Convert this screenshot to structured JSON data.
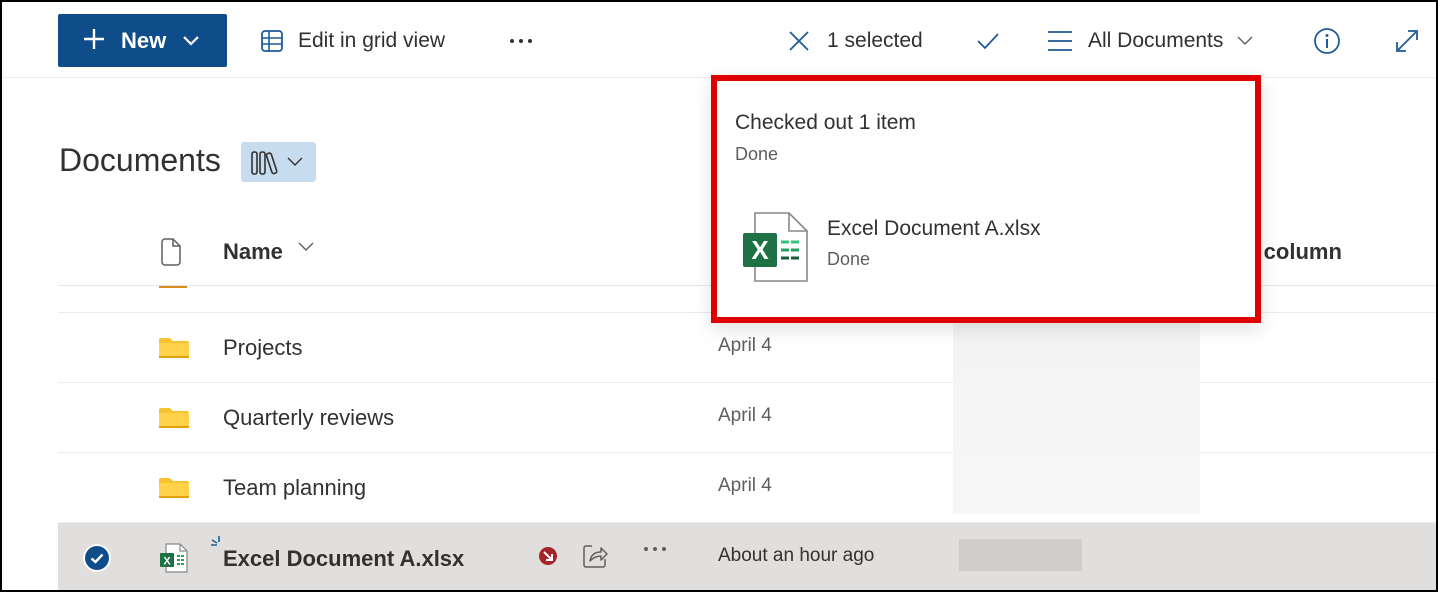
{
  "toolbar": {
    "new_label": "New",
    "edit_grid_label": "Edit in grid view",
    "more_label": "···",
    "selection_count_label": "1 selected",
    "view_label": "All Documents",
    "icons": [
      "plus-icon",
      "chevron-down-icon",
      "grid-icon",
      "more-icon",
      "close-icon",
      "checkmark-icon",
      "view-lines-icon",
      "info-icon",
      "expand-icon"
    ],
    "accent_color": "#0f4c8a"
  },
  "library": {
    "title": "Documents",
    "library_switcher_icon": "library-books-icon"
  },
  "list": {
    "columns": {
      "type_icon": "file-icon",
      "name": "Name",
      "add_column": "+ Add column"
    },
    "add_column_visible": "ld column",
    "rows": [
      {
        "type": "folder",
        "name": "Projects",
        "modified": "April 4"
      },
      {
        "type": "folder",
        "name": "Quarterly reviews",
        "modified": "April 4"
      },
      {
        "type": "folder",
        "name": "Team planning",
        "modified": "April 4"
      }
    ],
    "selected_row": {
      "type": "excel",
      "name": "Excel Document A.xlsx",
      "modified": "About an hour ago",
      "selected": true,
      "checked_out": true,
      "icons": [
        "check-circle-icon",
        "excel-file-icon",
        "new-sparkle-icon",
        "checked-out-icon",
        "share-icon",
        "more-icon"
      ]
    }
  },
  "notification": {
    "title": "Checked out 1 item",
    "status": "Done",
    "item": {
      "name": "Excel Document A.xlsx",
      "status": "Done",
      "icon": "excel-file-icon"
    },
    "highlight_color": "#e00000"
  }
}
